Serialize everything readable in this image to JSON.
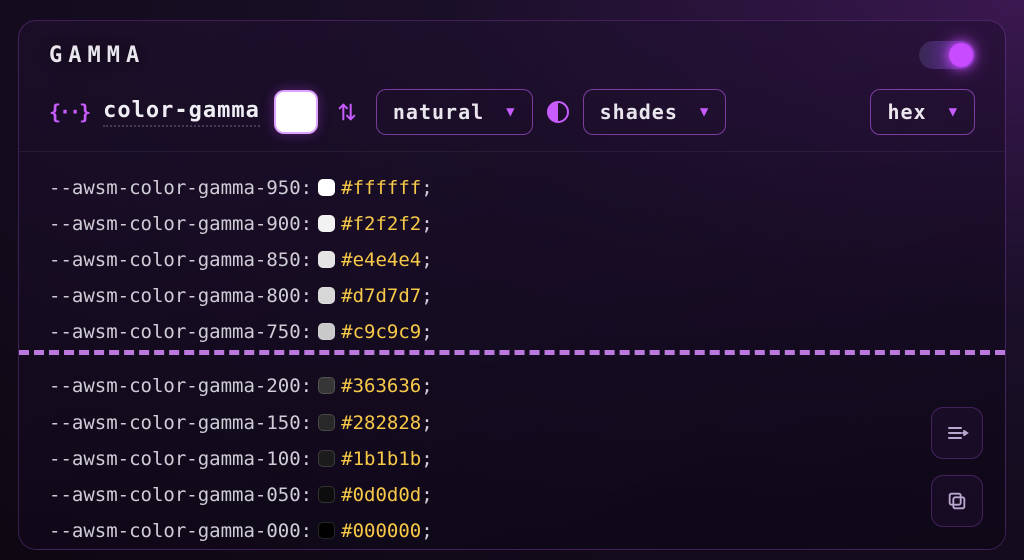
{
  "title": "GAMMA",
  "toggle_on": true,
  "name": "color-gamma",
  "primary_swatch": "#ffffff",
  "order_select": {
    "label": "natural"
  },
  "mode_select": {
    "label": "shades"
  },
  "format_select": {
    "label": "hex"
  },
  "vars_top": [
    {
      "name": "--awsm-color-gamma-950",
      "hex": "#ffffff",
      "sw": "#ffffff"
    },
    {
      "name": "--awsm-color-gamma-900",
      "hex": "#f2f2f2",
      "sw": "#f2f2f2"
    },
    {
      "name": "--awsm-color-gamma-850",
      "hex": "#e4e4e4",
      "sw": "#e4e4e4"
    },
    {
      "name": "--awsm-color-gamma-800",
      "hex": "#d7d7d7",
      "sw": "#d7d7d7"
    },
    {
      "name": "--awsm-color-gamma-750",
      "hex": "#c9c9c9",
      "sw": "#c9c9c9"
    }
  ],
  "vars_bottom": [
    {
      "name": "--awsm-color-gamma-200",
      "hex": "#363636",
      "sw": "#363636"
    },
    {
      "name": "--awsm-color-gamma-150",
      "hex": "#282828",
      "sw": "#282828"
    },
    {
      "name": "--awsm-color-gamma-100",
      "hex": "#1b1b1b",
      "sw": "#1b1b1b"
    },
    {
      "name": "--awsm-color-gamma-050",
      "hex": "#0d0d0d",
      "sw": "#0d0d0d"
    },
    {
      "name": "--awsm-color-gamma-000",
      "hex": "#000000",
      "sw": "#000000"
    }
  ]
}
